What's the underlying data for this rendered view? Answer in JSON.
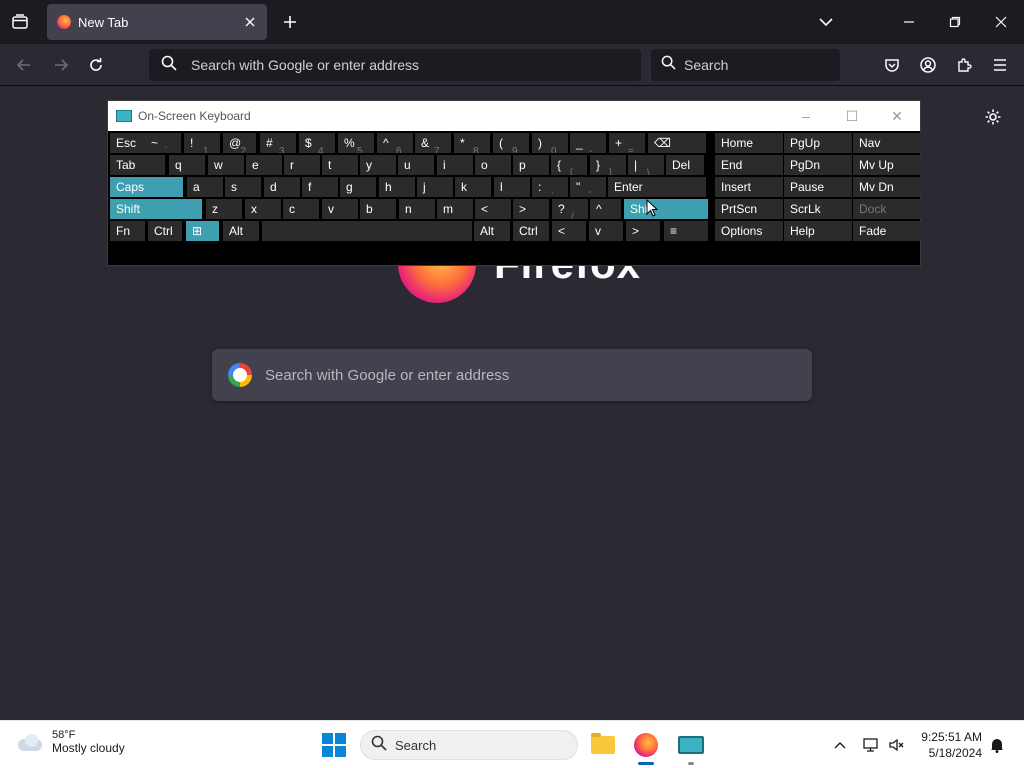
{
  "browser": {
    "tab": {
      "title": "New Tab"
    },
    "urlbar": {
      "placeholder": "Search with Google or enter address"
    },
    "searchbar": {
      "placeholder": "Search"
    }
  },
  "newtab": {
    "brand": "Firefox",
    "search_placeholder": "Search with Google or enter address"
  },
  "osk": {
    "title": "On-Screen Keyboard",
    "rows": {
      "r1": [
        {
          "label": "Esc"
        },
        {
          "label": "~",
          "sub": "`"
        },
        {
          "label": "!",
          "sub": "1"
        },
        {
          "label": "@",
          "sub": "2"
        },
        {
          "label": "#",
          "sub": "3"
        },
        {
          "label": "$",
          "sub": "4"
        },
        {
          "label": "%",
          "sub": "5"
        },
        {
          "label": "^",
          "sub": "6"
        },
        {
          "label": "&",
          "sub": "7"
        },
        {
          "label": "*",
          "sub": "8"
        },
        {
          "label": "(",
          "sub": "9"
        },
        {
          "label": ")",
          "sub": "0"
        },
        {
          "label": "_",
          "sub": "-"
        },
        {
          "label": "+",
          "sub": "="
        },
        {
          "label": "⌫"
        }
      ],
      "r2": [
        {
          "label": "Tab"
        },
        {
          "label": "q"
        },
        {
          "label": "w"
        },
        {
          "label": "e"
        },
        {
          "label": "r"
        },
        {
          "label": "t"
        },
        {
          "label": "y"
        },
        {
          "label": "u"
        },
        {
          "label": "i"
        },
        {
          "label": "o"
        },
        {
          "label": "p"
        },
        {
          "label": "{",
          "sub": "["
        },
        {
          "label": "}",
          "sub": "]"
        },
        {
          "label": "|",
          "sub": "\\"
        },
        {
          "label": "Del"
        }
      ],
      "r3": [
        {
          "label": "Caps"
        },
        {
          "label": "a"
        },
        {
          "label": "s"
        },
        {
          "label": "d"
        },
        {
          "label": "f"
        },
        {
          "label": "g"
        },
        {
          "label": "h"
        },
        {
          "label": "j"
        },
        {
          "label": "k"
        },
        {
          "label": "l"
        },
        {
          "label": ":",
          "sub": ";"
        },
        {
          "label": "\"",
          "sub": "'"
        },
        {
          "label": "Enter"
        }
      ],
      "r4": [
        {
          "label": "Shift"
        },
        {
          "label": "z"
        },
        {
          "label": "x"
        },
        {
          "label": "c"
        },
        {
          "label": "v"
        },
        {
          "label": "b"
        },
        {
          "label": "n"
        },
        {
          "label": "m"
        },
        {
          "label": "<",
          "sub": ","
        },
        {
          "label": ">",
          "sub": "."
        },
        {
          "label": "?",
          "sub": "/"
        },
        {
          "label": "^"
        },
        {
          "label": "Shift"
        }
      ],
      "r5": [
        {
          "label": "Fn"
        },
        {
          "label": "Ctrl"
        },
        {
          "label": "⊞"
        },
        {
          "label": "Alt"
        },
        {
          "label": ""
        },
        {
          "label": "Alt"
        },
        {
          "label": "Ctrl"
        },
        {
          "label": "<"
        },
        {
          "label": "v"
        },
        {
          "label": ">"
        },
        {
          "label": "≡"
        }
      ],
      "nav": [
        [
          "Home",
          "PgUp",
          "Nav"
        ],
        [
          "End",
          "PgDn",
          "Mv Up"
        ],
        [
          "Insert",
          "Pause",
          "Mv Dn"
        ],
        [
          "PrtScn",
          "ScrLk",
          "Dock"
        ],
        [
          "Options",
          "Help",
          "Fade"
        ]
      ]
    }
  },
  "taskbar": {
    "weather": {
      "temp": "58°F",
      "condition": "Mostly cloudy"
    },
    "search_placeholder": "Search",
    "clock": {
      "time": "9:25:51 AM",
      "date": "5/18/2024"
    }
  },
  "colors": {
    "osk_highlight": "#3d9fb0",
    "browser_bg": "#2b2a33",
    "accent": "#0067c0"
  }
}
